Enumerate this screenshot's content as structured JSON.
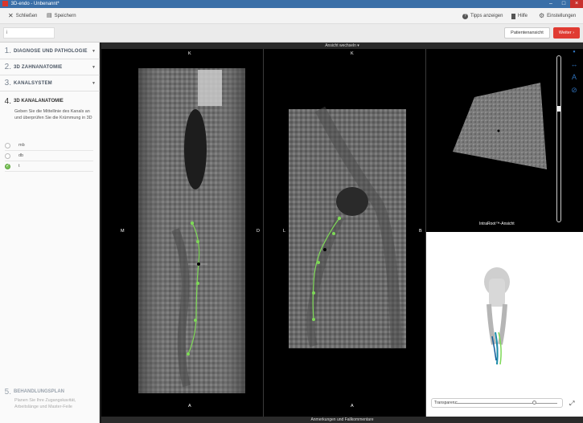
{
  "window": {
    "title": "3D-endo - Unbenannt*"
  },
  "menubar": {
    "close_label": "Schließen",
    "save_label": "Speichern",
    "tips_label": "Tipps anzeigen",
    "help_label": "Hilfe",
    "settings_label": "Einstellungen"
  },
  "toolbar": {
    "search_value": "i",
    "patient_view_label": "Patientenansicht",
    "next_label": "Weiter"
  },
  "sidebar": {
    "steps": [
      {
        "num": "1.",
        "label": "DIAGNOSE UND PATHOLOGIE"
      },
      {
        "num": "2.",
        "label": "3D ZAHNANATOMIE"
      },
      {
        "num": "3.",
        "label": "KANALSYSTEM"
      }
    ],
    "active_step": {
      "num": "4.",
      "label": "3D KANALANATOMIE",
      "description": "Geben Sie die Mittellinie des Kanals an und überprüfen Sie die Krümmung in 3D"
    },
    "canals": [
      {
        "label": "mb",
        "checked": false
      },
      {
        "label": "db",
        "checked": false
      },
      {
        "label": "t",
        "checked": true
      }
    ],
    "next_step": {
      "num": "5.",
      "label": "BEHANDLUNGSPLAN",
      "description": "Planen Sie Ihre Zugangskavität, Arbeitslänge und Master-Feile"
    }
  },
  "viewer": {
    "view_switch_label": "Ansicht wechseln",
    "footer_label": "Anmerkungen und Fallkommentare",
    "pane1": {
      "top": "K",
      "bottom": "A",
      "left": "M",
      "right": "D"
    },
    "pane2": {
      "top": "K",
      "bottom": "A",
      "left": "L",
      "right": "B"
    },
    "intraroot_label": "IntraRoot™-Ansicht",
    "transparency_label": "Transparenz:",
    "transparency_level": 0.78
  },
  "icons": {
    "close": "close-icon",
    "save": "save-icon",
    "tips": "help-circle-icon",
    "help": "book-icon",
    "settings": "gear-icon",
    "view_switch": "chevron-down-icon",
    "annotation": "comment-icon",
    "measure": "ruler-icon",
    "text": "text-icon",
    "compass": "compass-icon",
    "expand": "expand-icon"
  },
  "colors": {
    "accent_red": "#e03b32",
    "path_green": "#7ed957",
    "tool_blue": "#2e6fb7"
  }
}
